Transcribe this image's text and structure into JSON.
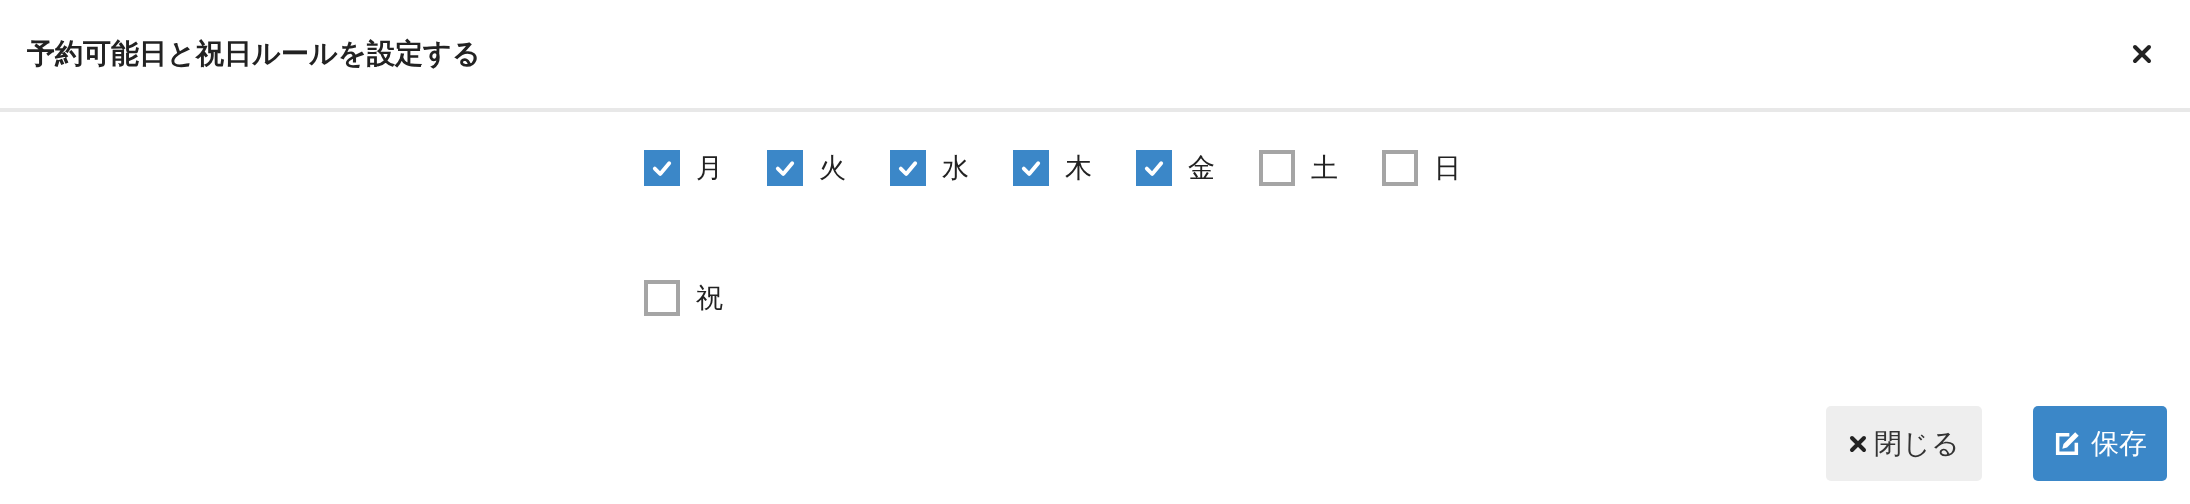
{
  "dialog": {
    "title": "予約可能日と祝日ルールを設定する"
  },
  "weekdays": [
    {
      "label": "月",
      "checked": true
    },
    {
      "label": "火",
      "checked": true
    },
    {
      "label": "水",
      "checked": true
    },
    {
      "label": "木",
      "checked": true
    },
    {
      "label": "金",
      "checked": true
    },
    {
      "label": "土",
      "checked": false
    },
    {
      "label": "日",
      "checked": false
    }
  ],
  "holiday": {
    "label": "祝",
    "checked": false
  },
  "buttons": [
    {
      "label": "閉じる",
      "kind": "close"
    },
    {
      "label": "保存",
      "kind": "save"
    }
  ]
}
